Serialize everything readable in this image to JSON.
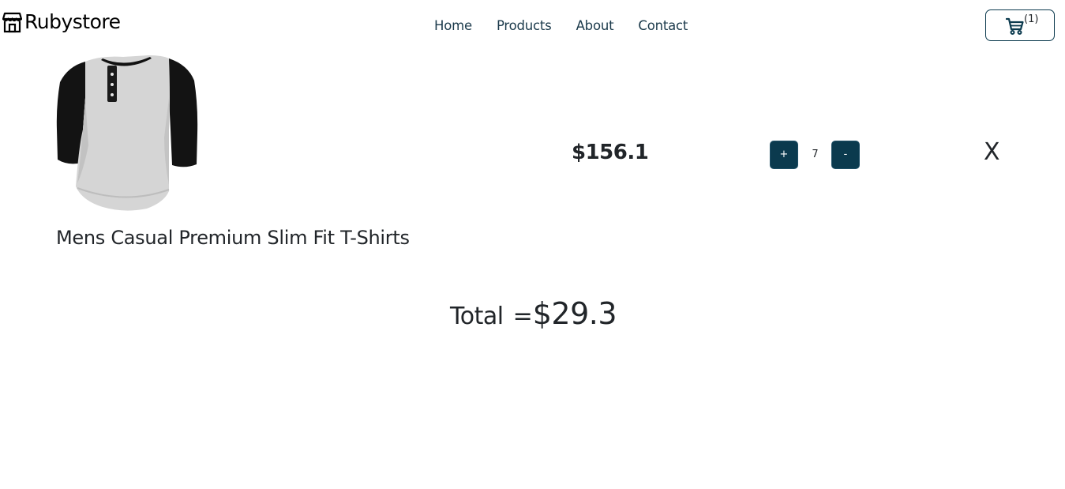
{
  "navbar": {
    "brand": "Rubystore",
    "brand_icon": "store-icon",
    "links": [
      "Home",
      "Products",
      "About",
      "Contact"
    ],
    "cart": {
      "icon": "cart-icon",
      "count": "(1)"
    }
  },
  "cart_item": {
    "image_icon": "henley-tshirt-image",
    "title": "Mens Casual Premium Slim Fit T-Shirts",
    "price": "$156.1",
    "increase_label": "+",
    "quantity": "7",
    "decrease_label": "-",
    "remove_label": "X"
  },
  "total": {
    "label": "Total",
    "equals": "=",
    "value": "$29.3"
  },
  "colors": {
    "accent": "#0b3a4e",
    "nav_text": "#1b3a4b",
    "text": "#212529",
    "background": "#ffffff"
  }
}
